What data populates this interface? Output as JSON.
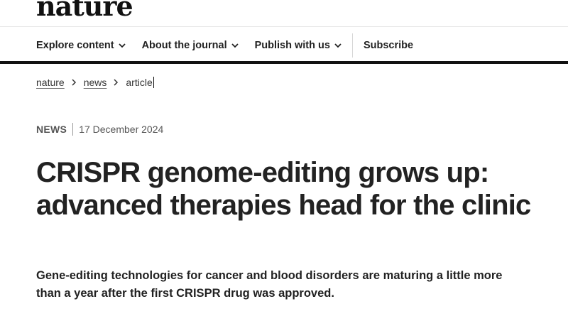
{
  "header": {
    "logo": "nature",
    "nav": [
      {
        "label": "Explore content",
        "has_dropdown": true,
        "icon": "chevron-down-icon"
      },
      {
        "label": "About the journal",
        "has_dropdown": true,
        "icon": "chevron-down-icon"
      },
      {
        "label": "Publish with us",
        "has_dropdown": true,
        "icon": "chevron-down-icon"
      },
      {
        "label": "Subscribe",
        "has_dropdown": false
      }
    ]
  },
  "breadcrumb": {
    "items": [
      "nature",
      "news",
      "article"
    ],
    "separator_icon": "chevron-right-icon"
  },
  "article": {
    "type": "NEWS",
    "date": "17 December 2024",
    "title": "CRISPR genome-editing grows up: advanced therapies head for the clinic",
    "standfirst": "Gene-editing technologies for cancer and blood disorders are maturing a little more than a year after the first CRISPR drug was approved."
  },
  "colors": {
    "text": "#222222",
    "rule": "#111111",
    "muted": "#555555"
  }
}
